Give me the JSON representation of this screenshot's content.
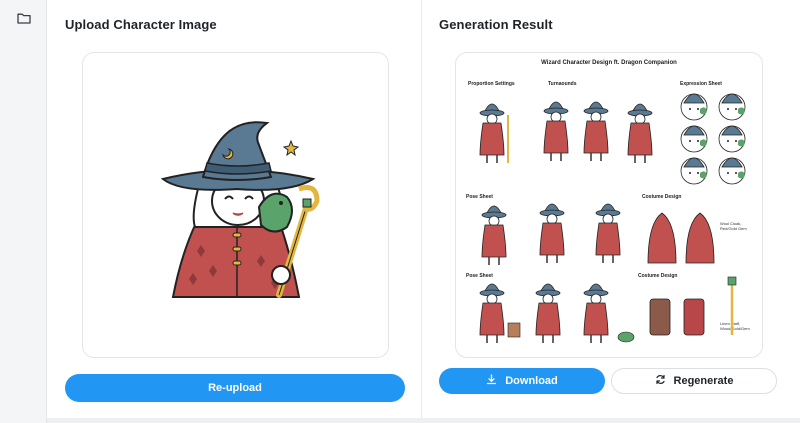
{
  "sidebar": {
    "icon": "folder-icon"
  },
  "upload_panel": {
    "title": "Upload Character Image",
    "reupload_label": "Re-upload"
  },
  "result_panel": {
    "title": "Generation Result",
    "download_label": "Download",
    "regenerate_label": "Regenerate",
    "sheet": {
      "title": "Wizard Character Design ft. Dragon Companion",
      "sections": {
        "proportion": "Proportion Settings",
        "turnarounds": "Turnaounds",
        "expression": "Expression Sheet",
        "pose1": "Pose Sheet",
        "costume1": "Costume Design",
        "pose2": "Pose Sheet",
        "costume2": "Costume Design"
      },
      "notes": {
        "cloak": "Wool Cloak, Red/Gold Gem",
        "staff": "Linen Staff, Wood/Gold/Gem"
      }
    }
  },
  "colors": {
    "primary": "#2196f3",
    "cloak": "#c0514f",
    "hat": "#5a7a93",
    "dragon": "#5aa36a",
    "staff": "#e2b640"
  }
}
